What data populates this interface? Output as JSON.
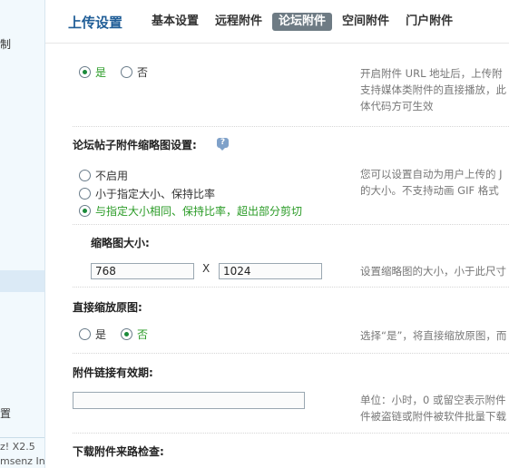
{
  "sidebar": {
    "item_top": "制",
    "item_bottom": "置",
    "footer_line1": "z! X2.5",
    "footer_line2": "msenz Inc."
  },
  "header": {
    "title": "上传设置",
    "tabs": [
      {
        "label": "基本设置",
        "active": false
      },
      {
        "label": "远程附件",
        "active": false
      },
      {
        "label": "论坛附件",
        "active": true
      },
      {
        "label": "空间附件",
        "active": false
      },
      {
        "label": "门户附件",
        "active": false
      }
    ]
  },
  "settings": {
    "media": {
      "options": [
        {
          "label": "是",
          "checked": true
        },
        {
          "label": "否",
          "checked": false
        }
      ],
      "desc": [
        "开启附件 URL 地址后，上传附",
        "支持媒体类附件的直接播放，此",
        "体代码方可生效"
      ]
    },
    "thumb_mode": {
      "label": "论坛帖子附件缩略图设置:",
      "help_icon": "?",
      "options": [
        {
          "label": "不启用",
          "checked": false
        },
        {
          "label": "小于指定大小、保持比率",
          "checked": false
        },
        {
          "label": "与指定大小相同、保持比率，超出部分剪切",
          "checked": true
        }
      ],
      "desc": [
        "您可以设置自动为用户上传的 J",
        "的大小。不支持动画 GIF 格式"
      ]
    },
    "thumb_size": {
      "label": "缩略图大小:",
      "width": "768",
      "separator": "X",
      "height": "1024",
      "desc": "设置缩略图的大小，小于此尺寸"
    },
    "direct_zoom": {
      "label": "直接缩放原图:",
      "options": [
        {
          "label": "是",
          "checked": false
        },
        {
          "label": "否",
          "checked": true
        }
      ],
      "desc": "选择“是”，将直接缩放原图，而"
    },
    "link_expire": {
      "label": "附件链接有效期:",
      "value": "",
      "desc": [
        "单位：小时，0 或留空表示附件",
        "件被盗链或附件被软件批量下载"
      ]
    },
    "referer_check": {
      "label": "下载附件来路检查:"
    }
  }
}
